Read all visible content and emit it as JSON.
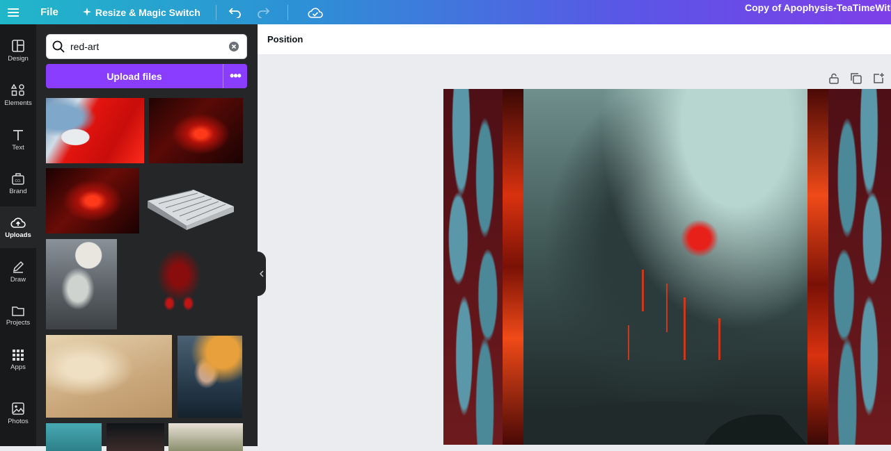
{
  "topbar": {
    "file_label": "File",
    "resize_label": "Resize & Magic Switch",
    "doc_title": "Copy of Apophysis-TeaTimeWithAI",
    "icons": [
      "hamburger-menu-icon",
      "undo-icon",
      "redo-icon",
      "cloud-check-icon"
    ]
  },
  "rail": {
    "items": [
      {
        "label": "Design",
        "icon": "layout-icon"
      },
      {
        "label": "Elements",
        "icon": "shapes-icon"
      },
      {
        "label": "Text",
        "icon": "text-icon"
      },
      {
        "label": "Brand",
        "icon": "brand-icon"
      },
      {
        "label": "Uploads",
        "icon": "cloud-upload-icon",
        "active": true
      },
      {
        "label": "Draw",
        "icon": "pen-icon"
      },
      {
        "label": "Projects",
        "icon": "folder-icon"
      },
      {
        "label": "Apps",
        "icon": "grid-icon"
      },
      {
        "label": "Photos",
        "icon": "image-icon"
      }
    ]
  },
  "panel": {
    "search_value": "red-art",
    "upload_label": "Upload files",
    "more_label": "•••"
  },
  "canvas": {
    "context_label": "Position",
    "tools": [
      "lock-icon",
      "duplicate-icon",
      "add-page-icon"
    ]
  },
  "colors": {
    "accent": "#8b3dff",
    "rail_bg": "#18191b",
    "panel_bg": "#252627",
    "canvas_bg": "#ebecf0"
  }
}
